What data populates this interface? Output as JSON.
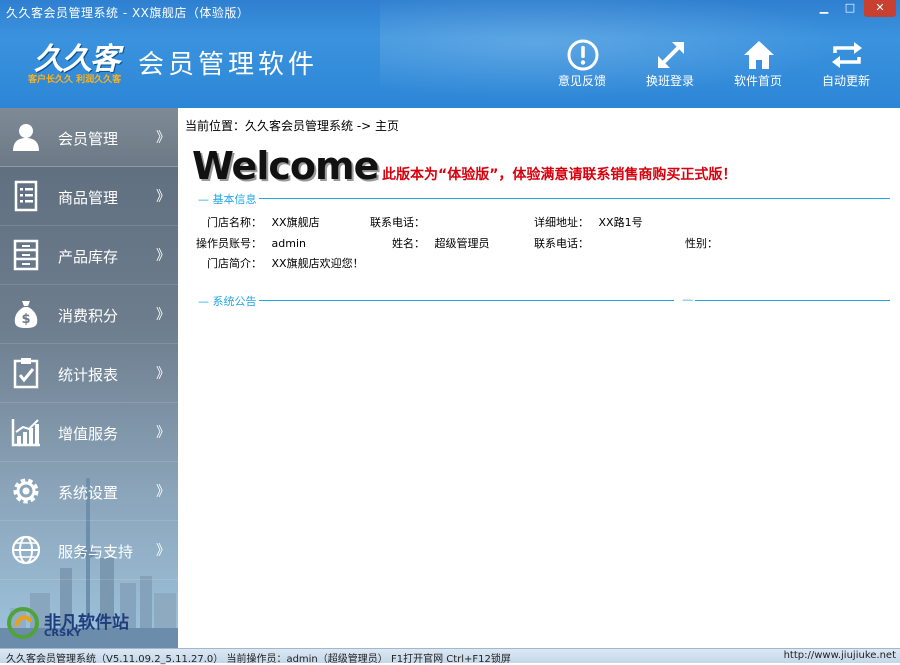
{
  "window": {
    "title": "久久客会员管理系统  - XX旗舰店（体验版）",
    "min_label": "▁",
    "max_label": "□",
    "close_label": "✕"
  },
  "header": {
    "logo_text": "久久客",
    "logo_slogan": "客户长久久  利润久久客",
    "app_name": "会员管理软件",
    "toolbar": [
      {
        "label": "意见反馈",
        "icon": "exclamation-circle-icon"
      },
      {
        "label": "换班登录",
        "icon": "expand-arrows-icon"
      },
      {
        "label": "软件首页",
        "icon": "home-icon"
      },
      {
        "label": "自动更新",
        "icon": "refresh-arrows-icon"
      }
    ]
  },
  "sidebar": {
    "arrow": "》",
    "items": [
      {
        "label": "会员管理",
        "icon": "user-icon"
      },
      {
        "label": "商品管理",
        "icon": "document-list-icon"
      },
      {
        "label": "产品库存",
        "icon": "cabinet-icon"
      },
      {
        "label": "消费积分",
        "icon": "money-bag-icon"
      },
      {
        "label": "统计报表",
        "icon": "clipboard-check-icon"
      },
      {
        "label": "增值服务",
        "icon": "bar-chart-icon"
      },
      {
        "label": "系统设置",
        "icon": "gear-icon"
      },
      {
        "label": "服务与支持",
        "icon": "globe-icon"
      }
    ],
    "watermark": "非凡软件站",
    "watermark_sub": "CRSKY"
  },
  "main": {
    "breadcrumb": "当前位置：久久客会员管理系统 -> 主页",
    "welcome": "Welcome",
    "trial_note": "此版本为“体验版”，体验满意请联系销售商购买正式版！",
    "basic_info_title": "基本信息",
    "info": {
      "store_name_label": "门店名称：",
      "store_name": "XX旗舰店",
      "phone_label": "联系电话：",
      "phone": "",
      "address_label": "详细地址：",
      "address": "XX路1号",
      "operator_account_label": "操作员账号：",
      "operator_account": "admin",
      "name_label": "姓名：",
      "name": "超级管理员",
      "phone2_label": "联系电话：",
      "phone2": "",
      "gender_label": "性别：",
      "gender": "",
      "intro_label": "门店简介：",
      "intro": "XX旗舰店欢迎您！"
    },
    "notice_title": "系统公告",
    "notice_right_title": "—"
  },
  "statusbar": {
    "left": "久久客会员管理系统（V5.11.09.2_5.11.27.0）  当前操作员：admin（超级管理员）  F1打开官网 Ctrl+F12锁屏",
    "right": "http://www.jiujiuke.net"
  },
  "colors": {
    "header_blue": "#2f7fd0",
    "accent": "#23a7e4",
    "trial_red": "#d8000c"
  }
}
